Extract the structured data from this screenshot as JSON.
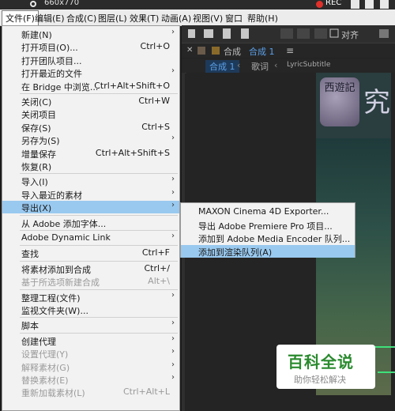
{
  "capture_bar": {
    "dimensions": "660x770",
    "rec_label": "REC",
    "icons": [
      "search-icon",
      "record-icon",
      "camera-icon",
      "pencil-icon",
      "close-icon"
    ]
  },
  "menubar": [
    {
      "label": "文件(F)",
      "active": true
    },
    {
      "label": "编辑(E)"
    },
    {
      "label": "合成(C)"
    },
    {
      "label": "图层(L)"
    },
    {
      "label": "效果(T)"
    },
    {
      "label": "动画(A)"
    },
    {
      "label": "视图(V)"
    },
    {
      "label": "窗口"
    },
    {
      "label": "帮助(H)"
    }
  ],
  "file_menu": [
    {
      "label": "新建(N)",
      "submenu": true
    },
    {
      "label": "打开项目(O)...",
      "shortcut": "Ctrl+O"
    },
    {
      "label": "打开团队项目..."
    },
    {
      "label": "打开最近的文件",
      "submenu": true
    },
    {
      "label": "在 Bridge 中浏览...",
      "shortcut": "Ctrl+Alt+Shift+O"
    },
    {
      "separator": true
    },
    {
      "label": "关闭(C)",
      "shortcut": "Ctrl+W"
    },
    {
      "label": "关闭项目"
    },
    {
      "label": "保存(S)",
      "shortcut": "Ctrl+S"
    },
    {
      "label": "另存为(S)",
      "submenu": true
    },
    {
      "label": "增量保存",
      "shortcut": "Ctrl+Alt+Shift+S"
    },
    {
      "label": "恢复(R)"
    },
    {
      "separator": true
    },
    {
      "label": "导入(I)",
      "submenu": true
    },
    {
      "label": "导入最近的素材",
      "submenu": true
    },
    {
      "label": "导出(X)",
      "submenu": true,
      "highlight": true
    },
    {
      "separator": true
    },
    {
      "label": "从 Adobe 添加字体..."
    },
    {
      "separator": true
    },
    {
      "label": "Adobe Dynamic Link",
      "submenu": true
    },
    {
      "separator": true
    },
    {
      "label": "查找",
      "shortcut": "Ctrl+F"
    },
    {
      "separator": true
    },
    {
      "label": "将素材添加到合成",
      "shortcut": "Ctrl+/"
    },
    {
      "label": "基于所选项新建合成",
      "shortcut": "Alt+\\",
      "disabled": true
    },
    {
      "separator": true
    },
    {
      "label": "整理工程(文件)",
      "submenu": true
    },
    {
      "label": "监视文件夹(W)..."
    },
    {
      "separator": true
    },
    {
      "label": "脚本",
      "submenu": true
    },
    {
      "separator": true
    },
    {
      "label": "创建代理",
      "submenu": true
    },
    {
      "label": "设置代理(Y)",
      "submenu": true,
      "disabled": true
    },
    {
      "label": "解释素材(G)",
      "submenu": true,
      "disabled": true
    },
    {
      "label": "替换素材(E)",
      "submenu": true,
      "disabled": true
    },
    {
      "label": "重新加载素材(L)",
      "shortcut": "Ctrl+Alt+L",
      "disabled": true
    }
  ],
  "export_submenu": [
    {
      "label": "MAXON Cinema 4D Exporter..."
    },
    {
      "label": "导出 Adobe Premiere Pro 项目..."
    },
    {
      "label": "添加到 Adobe Media Encoder 队列..."
    },
    {
      "label": "添加到渲染队列(A)",
      "highlight": true
    }
  ],
  "app": {
    "toolbar_snap_label": "对齐",
    "comp_tab_prefix": "合成",
    "comp_tab_name": "合成 1",
    "comp_sub_current": "合成 1",
    "comp_sub_items": [
      "歌词",
      "LyricSubtitle"
    ]
  },
  "viewer": {
    "logo_text": "西遊記",
    "logo_glyph": "究"
  },
  "watermark": {
    "title": "百科全说",
    "subtitle": "助你轻松解决"
  },
  "colors": {
    "menu_highlight": "#99c9ef",
    "record_red": "#e0302a",
    "accent_blue": "#3a8ad8",
    "watermark_green": "#2a8a2e"
  }
}
